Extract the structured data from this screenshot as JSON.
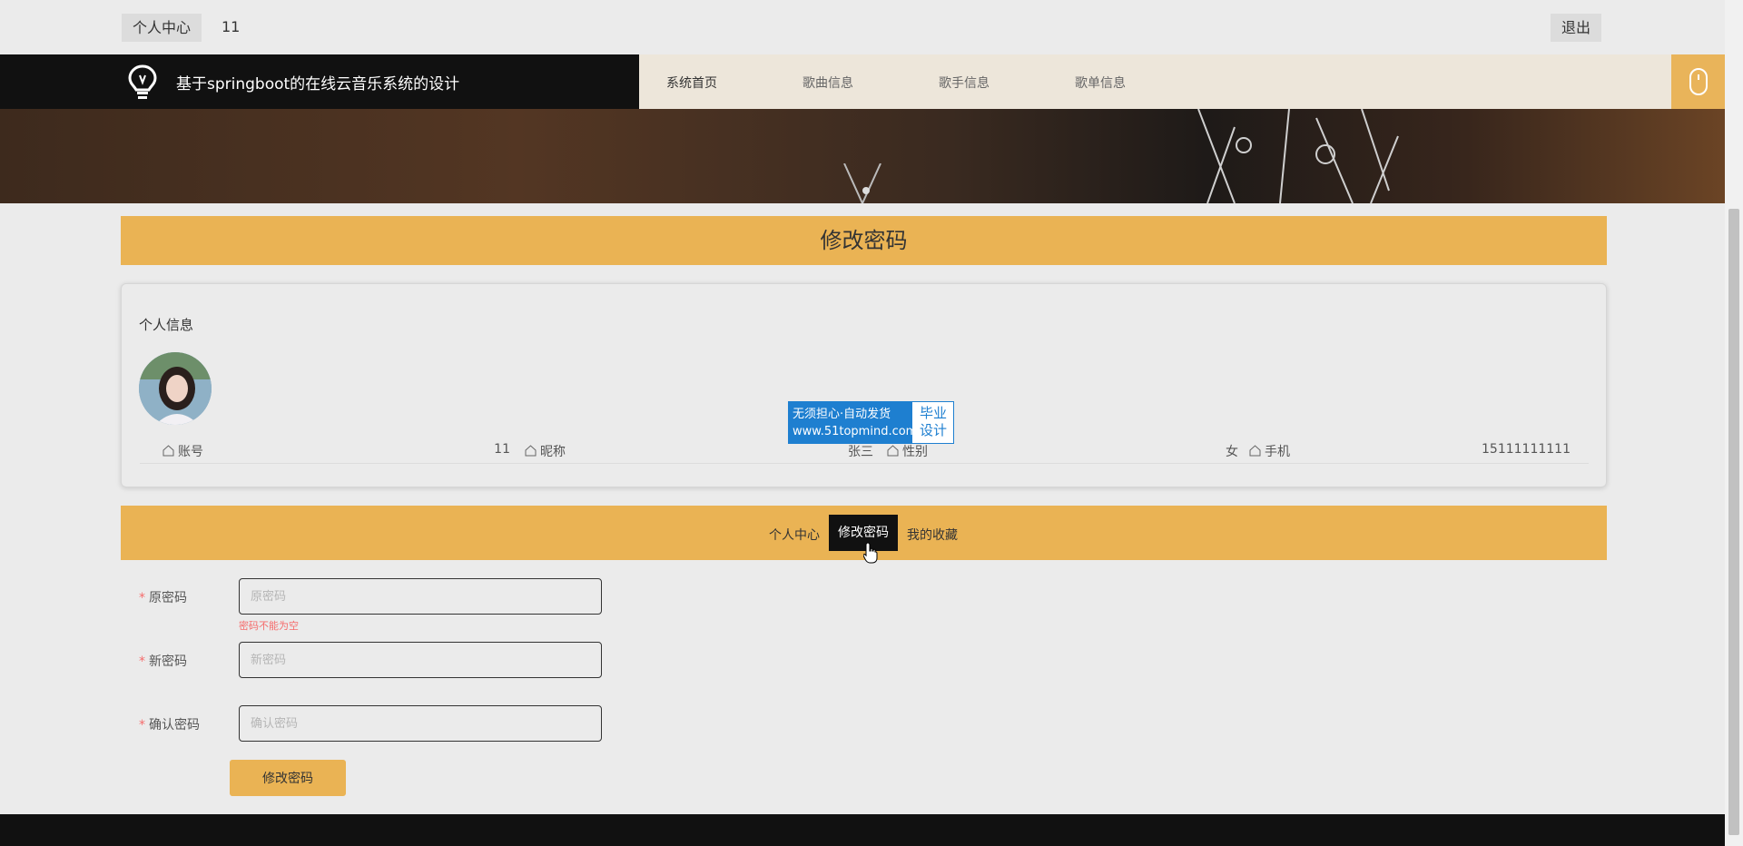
{
  "topbar": {
    "user_center": "个人中心",
    "username": "11",
    "logout": "退出"
  },
  "header": {
    "site_name": "基于springboot的在线云音乐系统的设计",
    "nav": [
      "系统首页",
      "歌曲信息",
      "歌手信息",
      "歌单信息"
    ],
    "active_nav": "系统首页"
  },
  "page_title": "修改密码",
  "profile": {
    "title": "个人信息",
    "fields": [
      {
        "label": "账号",
        "value": "11"
      },
      {
        "label": "昵称",
        "value": "张三"
      },
      {
        "label": "性别",
        "value": "女"
      },
      {
        "label": "手机",
        "value": "15111111111"
      }
    ]
  },
  "watermark": {
    "line1": "无须担心·自动发货",
    "line2": "www.51topmind.com",
    "side1": "毕业",
    "side2": "设计"
  },
  "tabs": {
    "items": [
      "个人中心",
      "修改密码",
      "我的收藏"
    ],
    "active": "修改密码"
  },
  "form": {
    "old_password": {
      "label": "原密码",
      "placeholder": "原密码",
      "error": "密码不能为空"
    },
    "new_password": {
      "label": "新密码",
      "placeholder": "新密码"
    },
    "confirm_password": {
      "label": "确认密码",
      "placeholder": "确认密码"
    },
    "submit": "修改密码"
  },
  "colors": {
    "accent": "#eab354",
    "dark": "#111111",
    "nav_bg": "#ede6da",
    "page_bg": "#ebebeb",
    "error": "#f56c6c"
  }
}
